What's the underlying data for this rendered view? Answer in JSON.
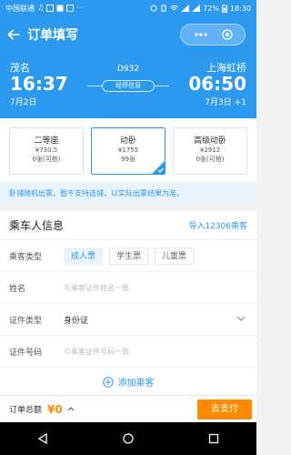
{
  "status_bar": {
    "carrier": "中国联通",
    "battery": "72%",
    "time": "18:30"
  },
  "header": {
    "title": "订单填写"
  },
  "train": {
    "number": "D932",
    "timetable_label": "经停信息",
    "from": {
      "station": "茂名",
      "time": "16:37",
      "date": "7月2日"
    },
    "to": {
      "station": "上海虹桥",
      "time": "06:50",
      "date": "7月3日",
      "day_offset": "+1"
    }
  },
  "seats": [
    {
      "name": "二等座",
      "price": "¥730.5",
      "count": "0张(可抢)",
      "selected": false
    },
    {
      "name": "动卧",
      "price": "¥1755",
      "count": "99张",
      "selected": true
    },
    {
      "name": "高级动卧",
      "price": "¥2912",
      "count": "0张(可抢)",
      "selected": false
    }
  ],
  "notice": "卧铺随机出票，暂不支持选铺，以实际出票结果为准。",
  "passenger": {
    "title": "乘车人信息",
    "import_label": "导入12306乘客",
    "type_label": "乘客类型",
    "types": [
      "成人票",
      "学生票",
      "儿童票"
    ],
    "name_label": "姓名",
    "name_placeholder": "与乘客证件姓名一致",
    "id_type_label": "证件类型",
    "id_type_value": "身份证",
    "id_number_label": "证件号码",
    "id_number_placeholder": "与乘客证件号码一致",
    "add_label": "添加乘客"
  },
  "footer": {
    "total_label": "订单总额",
    "total_amount": "¥0",
    "pay_label": "去支付"
  },
  "colors": {
    "primary": "#2c99f0",
    "accent": "#ff8a00"
  }
}
